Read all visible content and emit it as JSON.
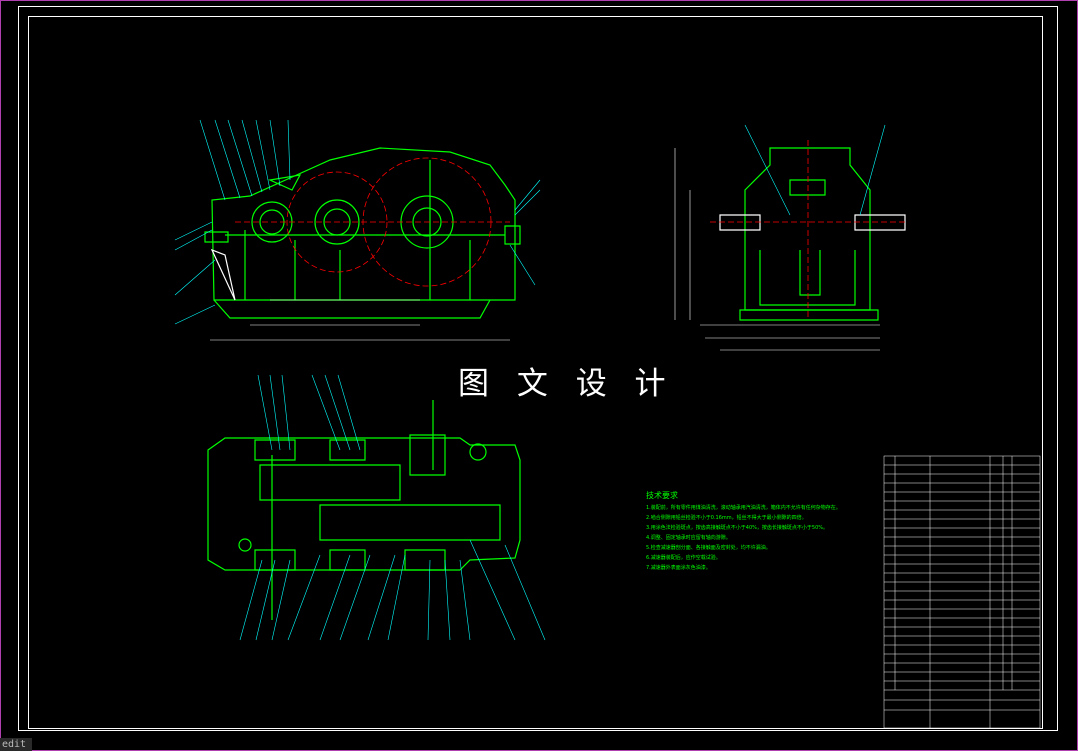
{
  "watermark": "图 文 设 计",
  "command_line": "edit",
  "technical_requirements": {
    "title": "技术要求",
    "lines": [
      "1.装配前，所有零件用煤油清洗，滚动轴承用汽油清洗，箱体内不允许有任何杂物存在。",
      "2.啮合侧隙用铅丝检验不小于0.16mm，铅丝不得大于最小侧隙的四倍。",
      "3.用涂色法检验斑点，按齿高接触斑点不小于40%，按齿长接触斑点不小于50%。",
      "4.调整、固定轴承时应留有轴向游隙。",
      "5.检查减速器剖分面、各接触面及密封处，均不许漏油。",
      "6.减速器装配后，应作空载试验。",
      "7.减速器外表面涂灰色油漆。"
    ]
  },
  "colors": {
    "background": "#000000",
    "outline": "#00ff00",
    "leader": "#00ffff",
    "center_line": "#ff0000",
    "dimension": "#ffffff",
    "frame": "#b040b0"
  },
  "icons": [
    "cad-drawing-sheet"
  ]
}
